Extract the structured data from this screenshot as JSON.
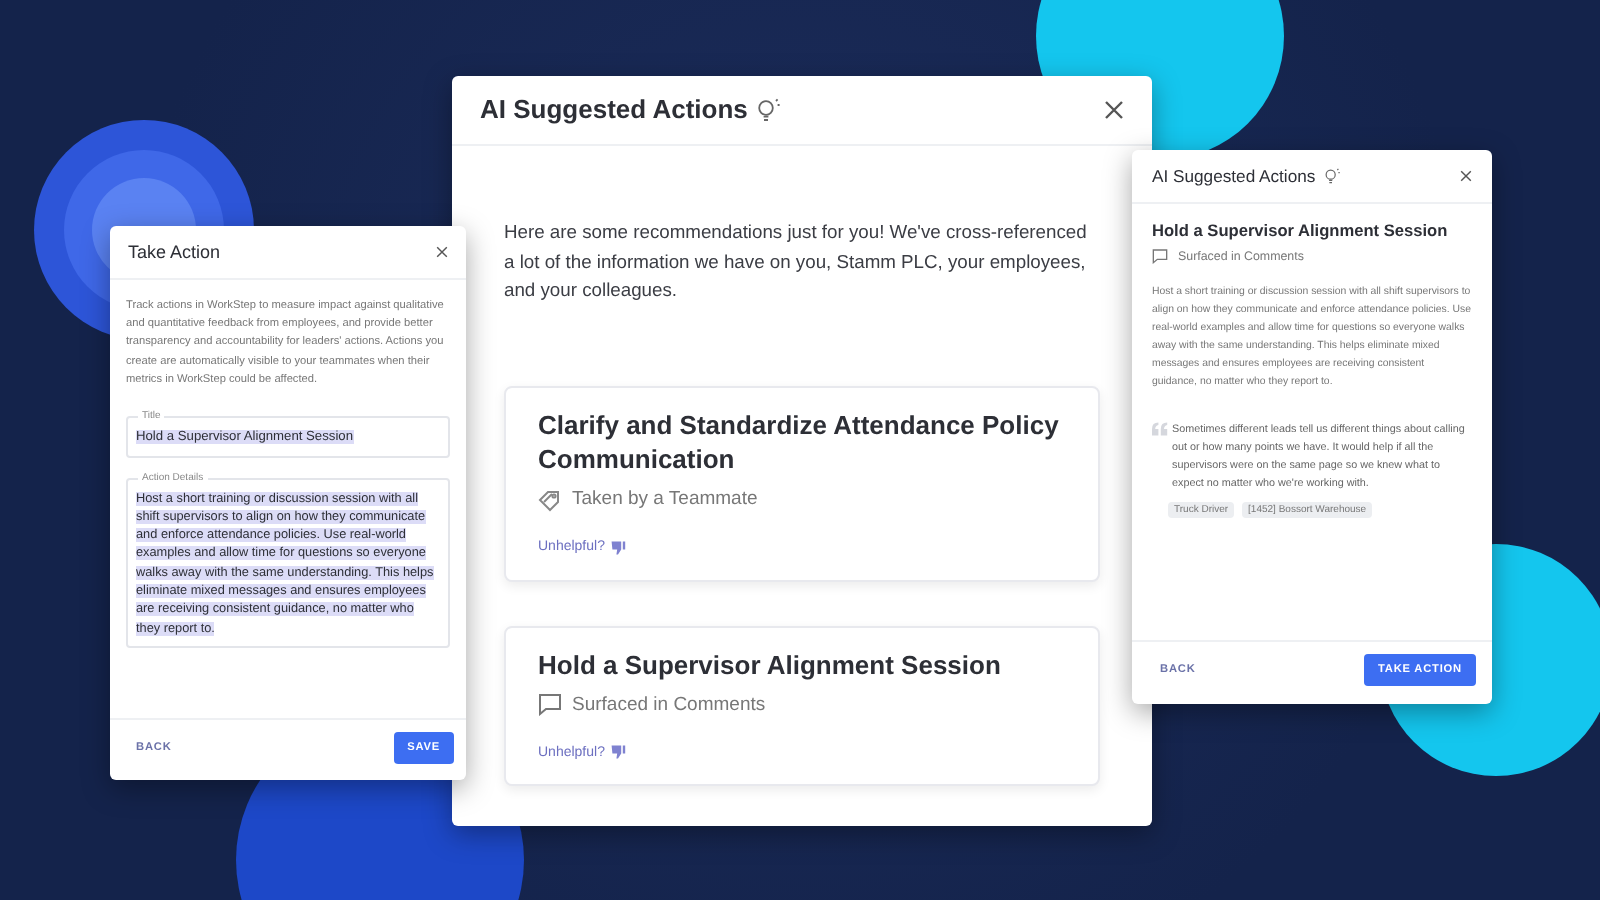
{
  "take_action_panel": {
    "title": "Take Action",
    "intro": "Track actions in WorkStep to measure impact against qualitative and quantitative feedback from employees, and provide better transparency and accountability for leaders' actions. Actions you create are automatically visible to your teammates when their metrics in WorkStep could be affected.",
    "fields": [
      {
        "label": "Title",
        "value": "Hold a Supervisor Alignment Session",
        "selected": true
      },
      {
        "label": "Action Details",
        "value": "Host a short training or discussion session with all shift supervisors to align on how they communicate and enforce attendance policies. Use real-world examples and allow time for questions so everyone walks away with the same understanding. This helps eliminate mixed messages and ensures employees are receiving consistent guidance, no matter who they report to.",
        "selected": true
      }
    ],
    "buttons": [
      {
        "label": "BACK",
        "kind": "text"
      },
      {
        "label": "SAVE",
        "kind": "primary"
      }
    ]
  },
  "main_panel": {
    "title": "AI Suggested Actions",
    "intro": "Here are some recommendations just for you! We've cross-referenced a lot of the information we have on you, Stamm PLC, your employees, and your colleagues.",
    "suggestions": [
      {
        "title": "Clarify and Standardize Attendance Policy Communication",
        "source": {
          "kind": "teammate",
          "label": "Taken by a Teammate"
        },
        "feedback": "Unhelpful?"
      },
      {
        "title": "Hold a Supervisor Alignment Session",
        "source": {
          "kind": "comments",
          "label": "Surfaced in Comments"
        },
        "feedback": "Unhelpful?"
      }
    ]
  },
  "detail_panel": {
    "title": "AI Suggested Actions",
    "heading": "Hold a Supervisor Alignment Session",
    "source": {
      "kind": "comments",
      "label": "Surfaced in Comments"
    },
    "description": "Host a short training or discussion session with all shift supervisors to align on how they communicate and enforce attendance policies. Use real-world examples and allow time for questions so everyone walks away with the same understanding. This helps eliminate mixed messages and ensures employees are receiving consistent guidance, no matter who they report to.",
    "quote": "Sometimes different leads tell us different things about calling out or how many points we have. It would help if all the supervisors were on the same page so we knew what to expect no matter who we're working with.",
    "tags": [
      "Truck Driver",
      "[1452] Bossort Warehouse"
    ],
    "buttons": [
      {
        "label": "BACK",
        "kind": "text"
      },
      {
        "label": "TAKE ACTION",
        "kind": "primary"
      }
    ]
  }
}
